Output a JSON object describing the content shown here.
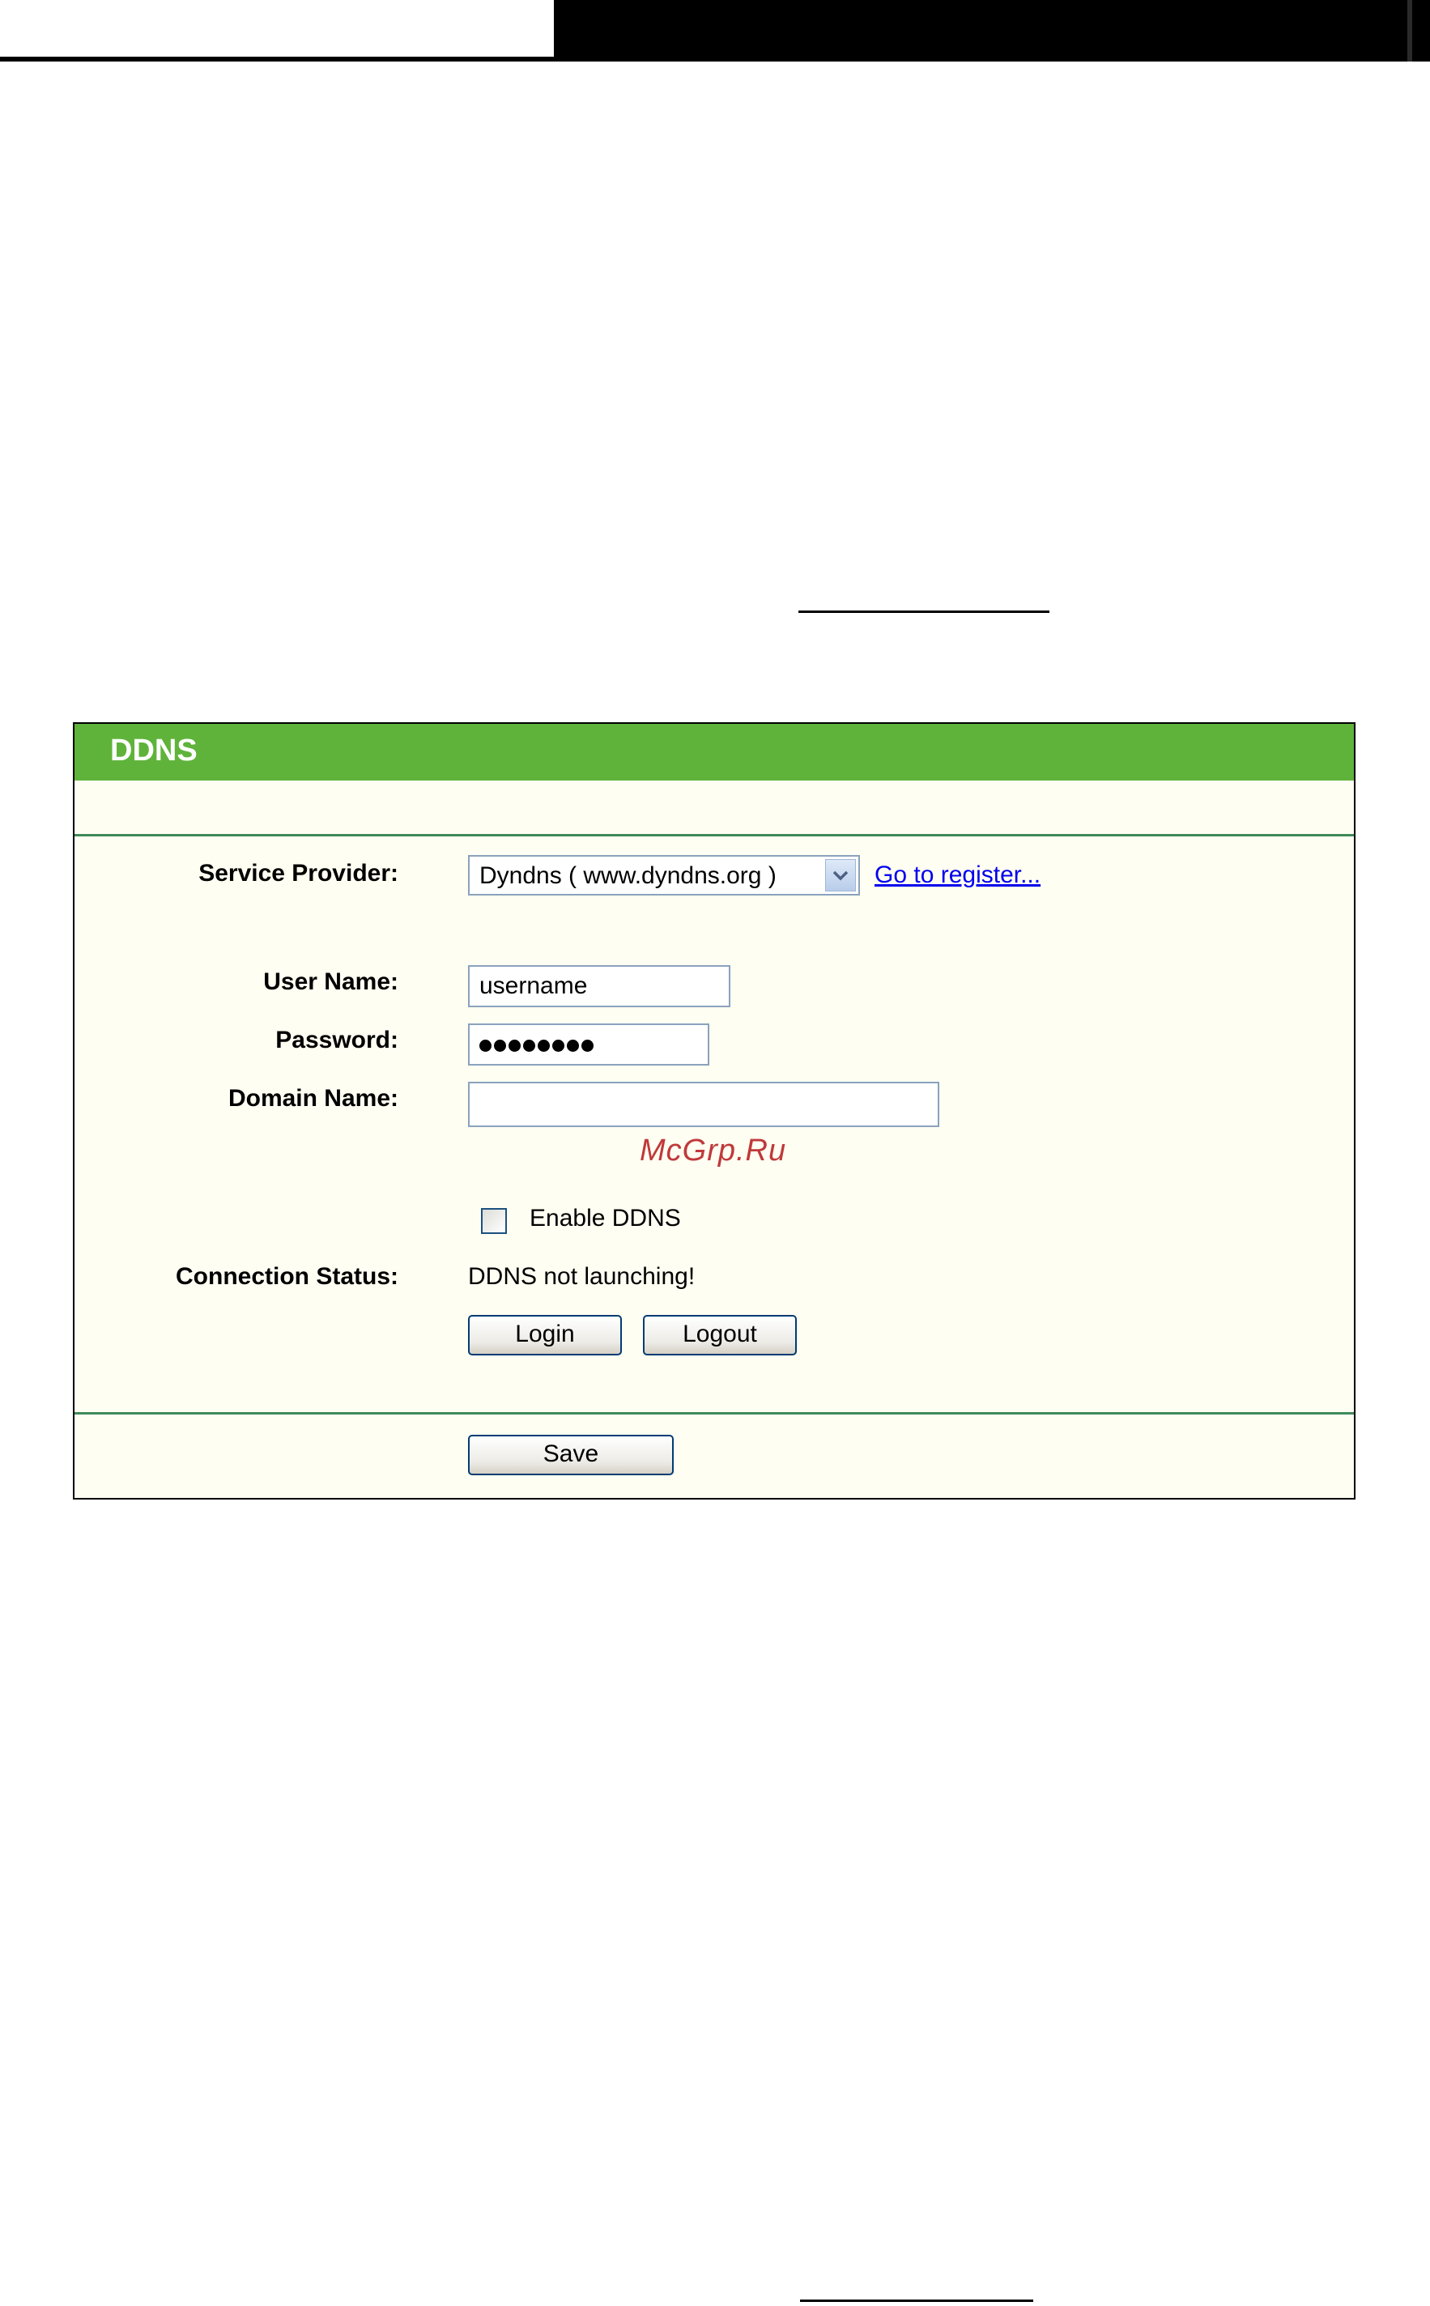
{
  "panel": {
    "title": "DDNS"
  },
  "form": {
    "service_provider": {
      "label": "Service Provider:",
      "selected": "Dyndns ( www.dyndns.org )",
      "register_link": "Go to register..."
    },
    "user_name": {
      "label": "User Name:",
      "value": "username"
    },
    "password": {
      "label": "Password:",
      "masked_length": 8
    },
    "domain_name": {
      "label": "Domain Name:",
      "value": ""
    },
    "enable_ddns": {
      "label": "Enable DDNS",
      "checked": false
    },
    "connection_status": {
      "label": "Connection Status:",
      "value": "DDNS not launching!"
    },
    "buttons": {
      "login": "Login",
      "logout": "Logout",
      "save": "Save"
    }
  },
  "watermark": "McGrp.Ru",
  "colors": {
    "header_green": "#5fb33a",
    "panel_bg": "#fefef2",
    "divider": "#3f8a5a",
    "link": "#0000ee",
    "watermark": "#c0393a"
  }
}
